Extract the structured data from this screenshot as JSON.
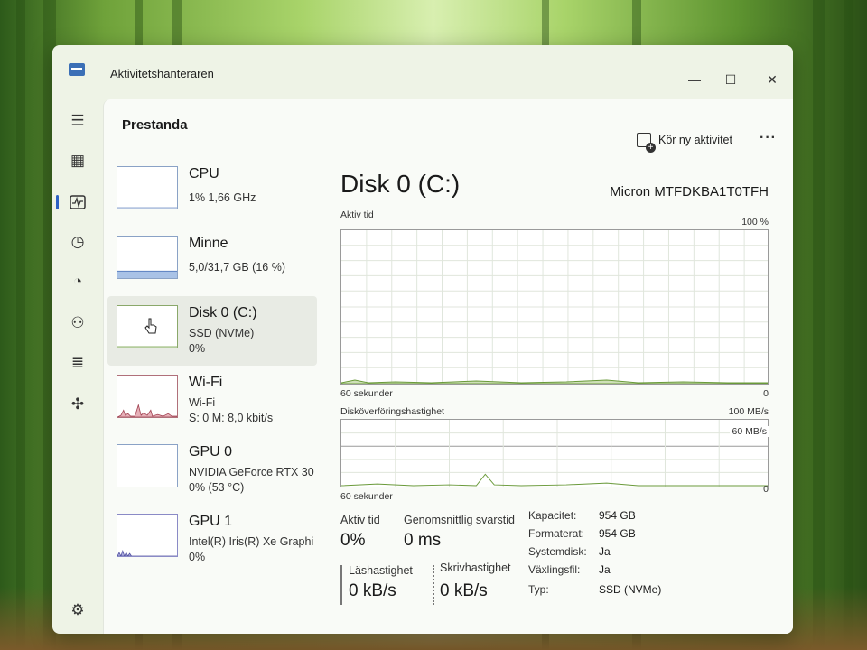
{
  "window": {
    "title": "Aktivitetshanteraren"
  },
  "header": {
    "page_title": "Prestanda",
    "run_task_label": "Kör ny aktivitet"
  },
  "devices": [
    {
      "name": "CPU",
      "sub1": "1%  1,66 GHz",
      "sub2": ""
    },
    {
      "name": "Minne",
      "sub1": "5,0/31,7 GB (16 %)",
      "sub2": ""
    },
    {
      "name": "Disk 0 (C:)",
      "sub1": "SSD (NVMe)",
      "sub2": "0%"
    },
    {
      "name": "Wi-Fi",
      "sub1": "Wi-Fi",
      "sub2": "S: 0  M: 8,0 kbit/s"
    },
    {
      "name": "GPU 0",
      "sub1": "NVIDIA GeForce RTX 30",
      "sub2": "0% (53 °C)"
    },
    {
      "name": "GPU 1",
      "sub1": "Intel(R) Iris(R) Xe Graphi",
      "sub2": "0%"
    }
  ],
  "detail": {
    "title": "Disk 0 (C:)",
    "model": "Micron MTFDKBA1T0TFH",
    "graph1": {
      "label": "Aktiv tid",
      "max": "100 %",
      "time": "60 sekunder",
      "min": "0"
    },
    "graph2": {
      "label": "Diskö­verföringshastighet",
      "max": "100 MB/s",
      "mid": "60 MB/s",
      "time": "60 sekunder",
      "min": "0"
    },
    "stats": {
      "active_label": "Aktiv tid",
      "active_value": "0%",
      "response_label": "Genomsnittlig svarstid",
      "response_value": "0 ms",
      "read_label": "Läshastighet",
      "read_value": "0 kB/s",
      "write_label": "Skrivhastighet",
      "write_value": "0 kB/s"
    },
    "props": [
      {
        "key": "Kapacitet:",
        "value": "954 GB"
      },
      {
        "key": "Formaterat:",
        "value": "954 GB"
      },
      {
        "key": "Systemdisk:",
        "value": "Ja"
      },
      {
        "key": "Växlingsfil:",
        "value": "Ja"
      },
      {
        "key": "Typ:",
        "value": "SSD (NVMe)"
      }
    ]
  },
  "icons": {
    "hamburger": "hamburger-icon",
    "processes": "processes-icon",
    "performance": "performance-icon",
    "history": "history-icon",
    "startup": "startup-icon",
    "users": "users-icon",
    "details": "details-icon",
    "services": "services-icon",
    "settings": "settings-icon"
  },
  "colors": {
    "accent": "#2d62c4",
    "disk_graph": "#6a9a3a",
    "wifi_graph": "#a04050",
    "gpu1_graph": "#5050a0"
  }
}
